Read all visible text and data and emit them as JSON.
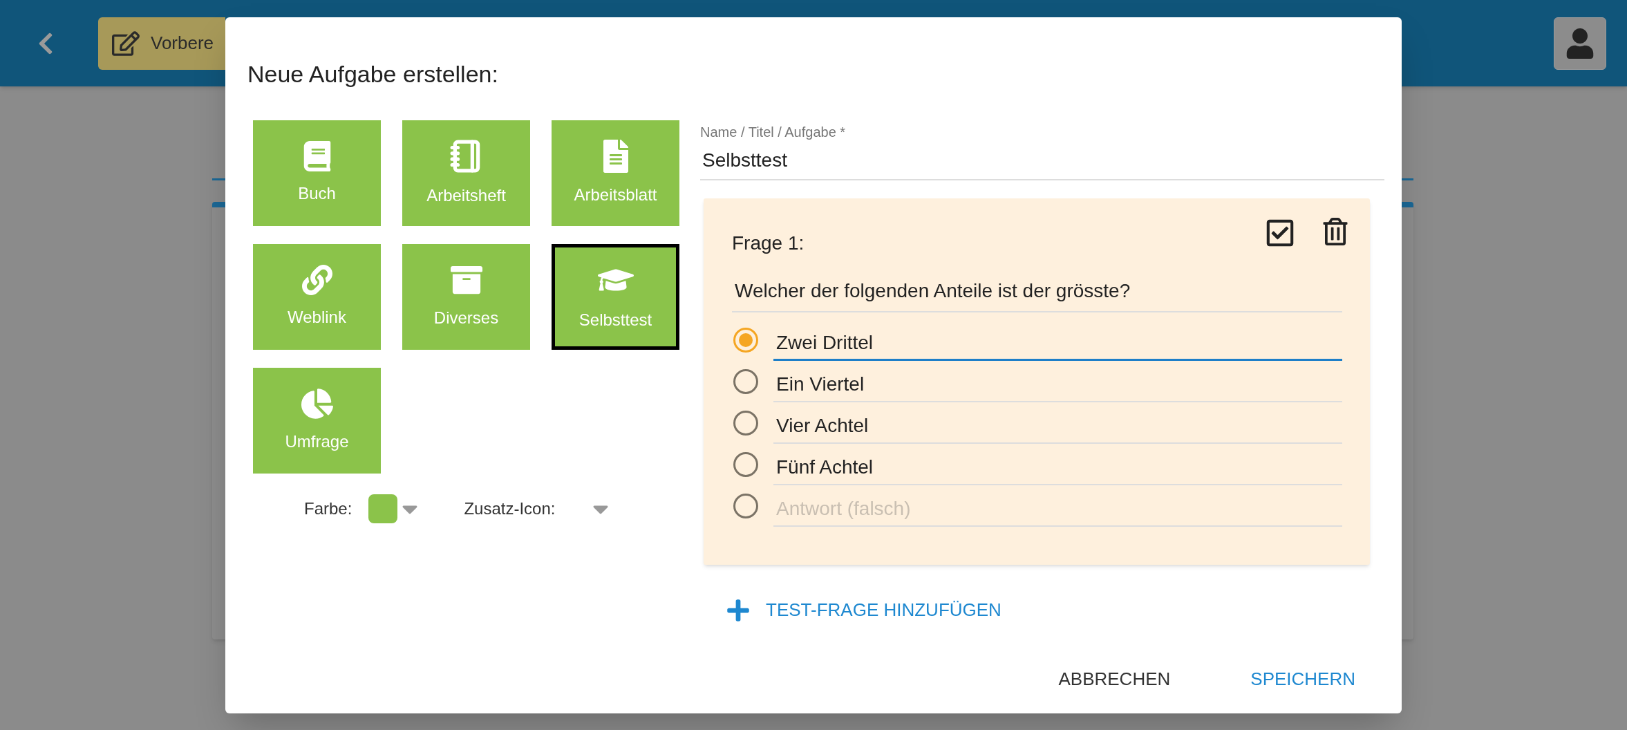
{
  "top_bar": {
    "button_label": "Vorbere"
  },
  "dialog": {
    "title": "Neue Aufgabe erstellen:",
    "tiles": [
      {
        "label": "Buch",
        "kind": "book",
        "selected": false
      },
      {
        "label": "Arbeitsheft",
        "kind": "notebook",
        "selected": false
      },
      {
        "label": "Arbeitsblatt",
        "kind": "sheet",
        "selected": false
      },
      {
        "label": "Weblink",
        "kind": "link",
        "selected": false
      },
      {
        "label": "Diverses",
        "kind": "box",
        "selected": false
      },
      {
        "label": "Selbsttest",
        "kind": "cap",
        "selected": true
      },
      {
        "label": "Umfrage",
        "kind": "pie",
        "selected": false
      }
    ],
    "color_picker": {
      "label": "Farbe:",
      "color": "#8bc34a"
    },
    "icon_picker": {
      "label": "Zusatz-Icon:"
    },
    "name_field": {
      "label": "Name / Titel / Aufgabe *",
      "value": "Selbsttest"
    },
    "questions": [
      {
        "title": "Frage 1:",
        "text": "Welcher der folgenden Anteile ist der grösste?",
        "answers": [
          {
            "value": "Zwei Drittel",
            "selected": true,
            "focused": true
          },
          {
            "value": "Ein Viertel",
            "selected": false,
            "focused": false
          },
          {
            "value": "Vier Achtel",
            "selected": false,
            "focused": false
          },
          {
            "value": "Fünf Achtel",
            "selected": false,
            "focused": false
          },
          {
            "placeholder": "Antwort (falsch)",
            "selected": false,
            "focused": false
          }
        ]
      }
    ],
    "add_question": "TEST-FRAGE HINZUFÜGEN",
    "buttons": [
      {
        "label": "ABBRECHEN",
        "kind": "secondary"
      },
      {
        "label": "SPEICHERN",
        "kind": "primary"
      }
    ]
  }
}
